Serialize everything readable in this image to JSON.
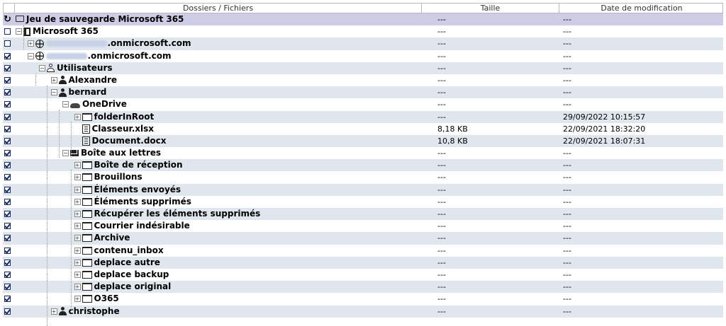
{
  "columns": {
    "name": "Dossiers / Fichiers",
    "size": "Taille",
    "date": "Date de modification"
  },
  "rows": [
    {
      "label": "Jeu de sauvegarde Microsoft 365",
      "level": 0,
      "icon": "monitor-icon",
      "checkbox": "refresh",
      "size": "---",
      "date": "---",
      "expander": false
    },
    {
      "label": "Microsoft 365",
      "level": 0,
      "icon": "office-icon",
      "checkbox": "unchecked",
      "size": "---",
      "date": "---",
      "expander": "minus"
    },
    {
      "label": ".onmicrosoft.com",
      "prefix_blurred": true,
      "level": 1,
      "icon": "globe-icon",
      "checkbox": "unchecked",
      "size": "---",
      "date": "---",
      "expander": "plus"
    },
    {
      "label": ".onmicrosoft.com",
      "prefix_blurred": true,
      "prefix_short": true,
      "level": 1,
      "icon": "globe-icon",
      "checkbox": "checked",
      "size": "---",
      "date": "---",
      "expander": "minus"
    },
    {
      "label": "Utilisateurs",
      "level": 2,
      "icon": "users-icon",
      "checkbox": "checked",
      "size": "---",
      "date": "---",
      "expander": "minus"
    },
    {
      "label": "Alexandre",
      "level": 3,
      "icon": "user-icon",
      "checkbox": "checked",
      "size": "---",
      "date": "---",
      "expander": "plus"
    },
    {
      "label": "bernard",
      "level": 3,
      "icon": "user-icon",
      "checkbox": "checked",
      "size": "---",
      "date": "---",
      "expander": "minus"
    },
    {
      "label": "OneDrive",
      "level": 4,
      "icon": "cloud-icon",
      "checkbox": "checked",
      "size": "---",
      "date": "---",
      "expander": "minus"
    },
    {
      "label": "folderInRoot",
      "level": 5,
      "icon": "folder-icon",
      "checkbox": "checked",
      "size": "---",
      "date": "29/09/2022 10:15:57",
      "expander": "plus"
    },
    {
      "label": "Classeur.xlsx",
      "level": 5,
      "icon": "document-icon",
      "checkbox": "checked",
      "size": "8,18 KB",
      "date": "22/09/2021 18:32:20",
      "expander": false
    },
    {
      "label": "Document.docx",
      "level": 5,
      "icon": "document-icon",
      "checkbox": "checked",
      "size": "10,8 KB",
      "date": "22/09/2021 18:07:31",
      "expander": false
    },
    {
      "label": "Boîte aux lettres",
      "level": 4,
      "icon": "mail-icon",
      "checkbox": "checked",
      "size": "---",
      "date": "---",
      "expander": "minus"
    },
    {
      "label": "Boîte de réception",
      "level": 5,
      "icon": "folder-icon",
      "checkbox": "checked",
      "size": "---",
      "date": "---",
      "expander": "plus"
    },
    {
      "label": "Brouillons",
      "level": 5,
      "icon": "folder-icon",
      "checkbox": "checked",
      "size": "---",
      "date": "---",
      "expander": "plus"
    },
    {
      "label": "Éléments envoyés",
      "level": 5,
      "icon": "folder-icon",
      "checkbox": "checked",
      "size": "---",
      "date": "---",
      "expander": "plus"
    },
    {
      "label": "Éléments supprimés",
      "level": 5,
      "icon": "folder-icon",
      "checkbox": "checked",
      "size": "---",
      "date": "---",
      "expander": "plus"
    },
    {
      "label": "Récupérer les éléments supprimés",
      "level": 5,
      "icon": "folder-icon",
      "checkbox": "checked",
      "size": "---",
      "date": "---",
      "expander": "plus"
    },
    {
      "label": "Courrier indésirable",
      "level": 5,
      "icon": "folder-icon",
      "checkbox": "checked",
      "size": "---",
      "date": "---",
      "expander": "plus"
    },
    {
      "label": "Archive",
      "level": 5,
      "icon": "folder-icon",
      "checkbox": "checked",
      "size": "---",
      "date": "---",
      "expander": "plus"
    },
    {
      "label": "contenu_inbox",
      "level": 5,
      "icon": "folder-icon",
      "checkbox": "checked",
      "size": "---",
      "date": "---",
      "expander": "plus"
    },
    {
      "label": "deplace autre",
      "level": 5,
      "icon": "folder-icon",
      "checkbox": "checked",
      "size": "---",
      "date": "---",
      "expander": "plus"
    },
    {
      "label": "deplace backup",
      "level": 5,
      "icon": "folder-icon",
      "checkbox": "checked",
      "size": "---",
      "date": "---",
      "expander": "plus"
    },
    {
      "label": "deplace original",
      "level": 5,
      "icon": "folder-icon",
      "checkbox": "checked",
      "size": "---",
      "date": "---",
      "expander": "plus"
    },
    {
      "label": "O365",
      "level": 5,
      "icon": "folder-icon",
      "checkbox": "checked",
      "size": "---",
      "date": "---",
      "expander": "plus"
    },
    {
      "label": "christophe",
      "level": 3,
      "icon": "user-icon",
      "checkbox": "checked",
      "size": "---",
      "date": "---",
      "expander": "plus"
    }
  ]
}
